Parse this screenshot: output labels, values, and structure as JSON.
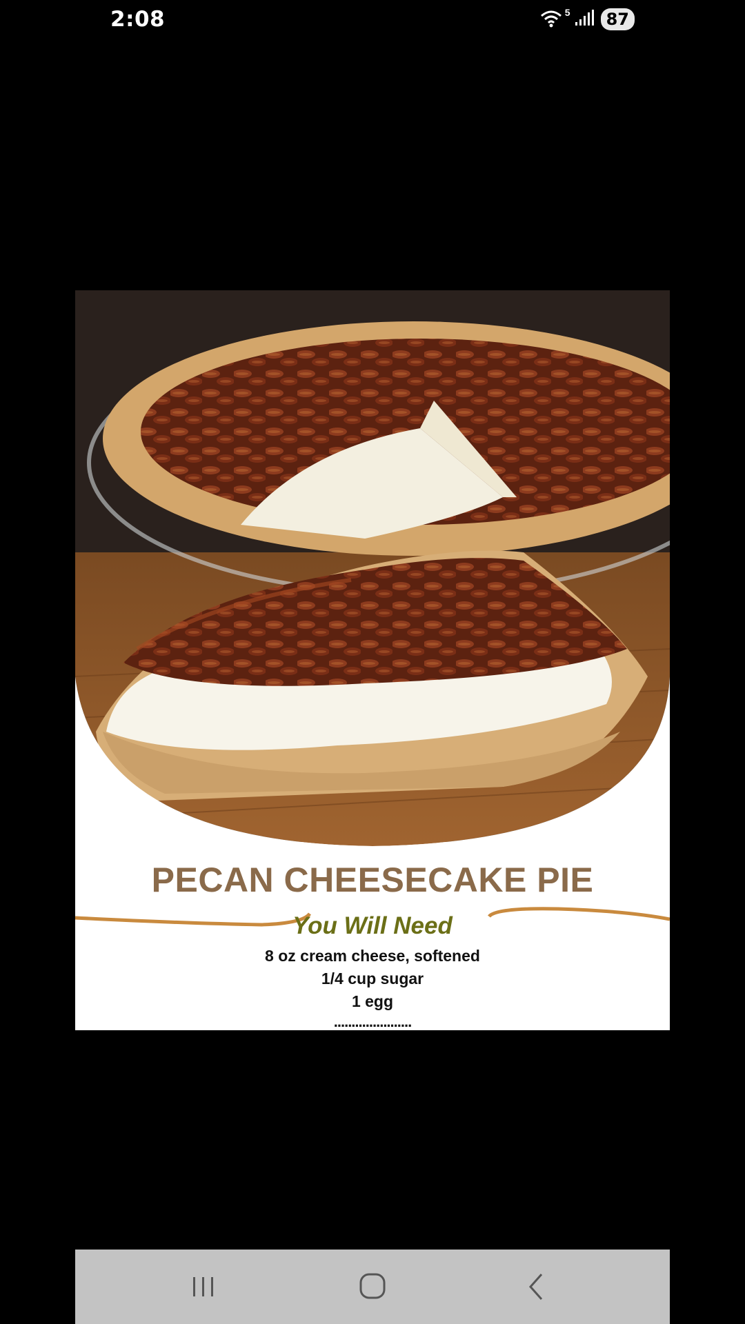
{
  "status_bar": {
    "time": "2:08",
    "wifi_icon": "wifi-icon",
    "wifi_label": "5",
    "signal_icon": "signal-icon",
    "battery": "87"
  },
  "post": {
    "title": "PECAN CHEESECAKE PIE",
    "subtitle": "You Will Need",
    "ingredients": [
      "8 oz cream cheese, softened",
      "1/4 cup sugar",
      "1 egg"
    ],
    "more_indicator": "......................",
    "accent_color": "#c98a3e",
    "title_color": "#8a6a4a",
    "subtitle_color": "#6b6f17"
  },
  "nav_bar": {
    "recents_icon": "recents-icon",
    "home_icon": "home-icon",
    "back_icon": "back-icon"
  }
}
